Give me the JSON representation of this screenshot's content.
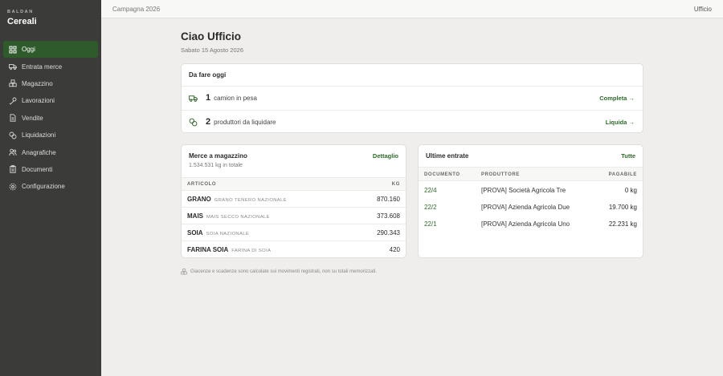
{
  "brand": {
    "small": "BALDAN",
    "name": "Cereali"
  },
  "topbar": {
    "campaign": "Campagna 2026",
    "user": "Ufficio"
  },
  "sidebar": {
    "items": [
      {
        "label": "Oggi",
        "icon": "grid-icon"
      },
      {
        "label": "Entrata merce",
        "icon": "truck-icon"
      },
      {
        "label": "Magazzino",
        "icon": "boxes-icon"
      },
      {
        "label": "Lavorazioni",
        "icon": "wrench-icon"
      },
      {
        "label": "Vendite",
        "icon": "document-icon"
      },
      {
        "label": "Liquidazioni",
        "icon": "coins-icon"
      },
      {
        "label": "Anagrafiche",
        "icon": "users-icon"
      },
      {
        "label": "Documenti",
        "icon": "clipboard-icon"
      },
      {
        "label": "Configurazione",
        "icon": "gear-icon"
      }
    ]
  },
  "header": {
    "greeting": "Ciao Ufficio",
    "date": "Sabato 15 Agosto 2026"
  },
  "todo": {
    "title": "Da fare oggi",
    "rows": [
      {
        "count": "1",
        "text": "camion in pesa",
        "action": "Completa →",
        "icon": "truck-icon"
      },
      {
        "count": "2",
        "text": "produttori da liquidare",
        "action": "Liquida →",
        "icon": "coins-icon"
      }
    ]
  },
  "stock": {
    "title": "Merce a magazzino",
    "subtitle": "1.534.531 kg in totale",
    "link": "Dettaglio",
    "columns": [
      "ARTICOLO",
      "KG"
    ],
    "rows": [
      {
        "name": "GRANO",
        "desc": "GRANO TENERO NAZIONALE",
        "kg": "870.160"
      },
      {
        "name": "MAIS",
        "desc": "MAIS SECCO NAZIONALE",
        "kg": "373.608"
      },
      {
        "name": "SOIA",
        "desc": "SOIA NAZIONALE",
        "kg": "290.343"
      },
      {
        "name": "FARINA SOIA",
        "desc": "FARINA DI SOIA",
        "kg": "420"
      }
    ]
  },
  "entries": {
    "title": "Ultime entrate",
    "link": "Tutte",
    "columns": [
      "DOCUMENTO",
      "PRODUTTORE",
      "PAGABILE"
    ],
    "rows": [
      {
        "doc": "22/4",
        "producer": "[PROVA] Società Agricola Tre",
        "payable": "0 kg"
      },
      {
        "doc": "22/2",
        "producer": "[PROVA] Azienda Agricola Due",
        "payable": "19.700 kg"
      },
      {
        "doc": "22/1",
        "producer": "[PROVA] Azienda Agricola Uno",
        "payable": "22.231 kg"
      }
    ]
  },
  "footnote": "Giacenze e scadenze sono calcolate sui movimenti registrati, non su totali memorizzati.",
  "colors": {
    "accent": "#2f6a2b",
    "sidebar_bg": "#3b3b39",
    "active_bg": "#2f5b2c"
  }
}
